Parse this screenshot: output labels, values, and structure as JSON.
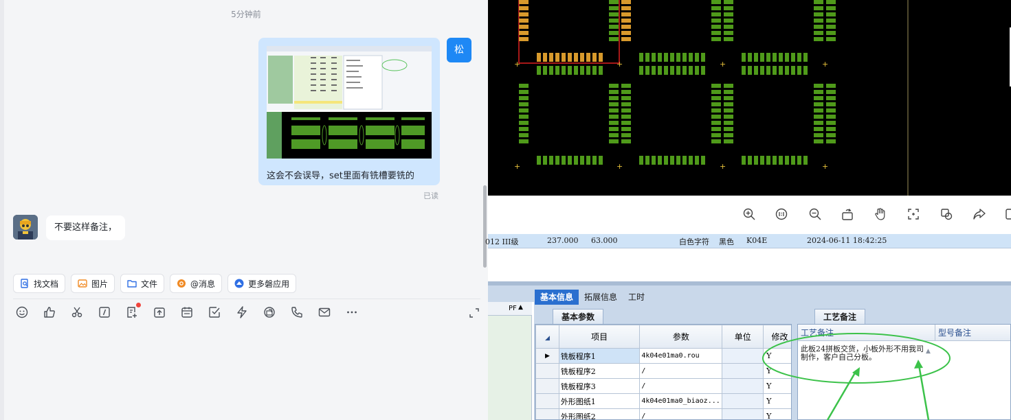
{
  "chat": {
    "timestamp": "5分钟前",
    "my_avatar_text": "松",
    "my_message": "这会不会误导，set里面有铣槽要铣的",
    "read_status": "已读",
    "other_message": "不要这样备注，",
    "quick_actions": [
      {
        "label": "找文档",
        "icon": "doc-search-icon",
        "color": "#2f6fe4"
      },
      {
        "label": "图片",
        "icon": "image-icon",
        "color": "#f08a24"
      },
      {
        "label": "文件",
        "icon": "folder-icon",
        "color": "#2f6fe4"
      },
      {
        "label": "@消息",
        "icon": "at-icon",
        "color": "#f08a24"
      },
      {
        "label": "更多磐应用",
        "icon": "apps-icon",
        "color": "#2f6fe4"
      }
    ],
    "toolbar_icons": [
      "emoji-icon",
      "thumbs-up-icon",
      "scissors-icon",
      "slash-command-icon",
      "notes-add-icon",
      "upload-icon",
      "calendar-icon",
      "checkbox-icon",
      "lightning-icon",
      "screen-share-icon",
      "call-icon",
      "mail-icon",
      "more-icon"
    ]
  },
  "viewer": {
    "toolbar_icons": [
      "zoom-in-icon",
      "actual-size-icon",
      "zoom-out-icon",
      "rotate-icon",
      "hand-icon",
      "crop-icon",
      "copy-icon",
      "share-icon",
      "save-icon"
    ]
  },
  "record": {
    "c1": "012 III级",
    "c2": "237.000",
    "c3": "63.000",
    "c4": "白色字符",
    "c5": "黑色",
    "c6": "K04E",
    "c7": "2024-06-11 18:42:25"
  },
  "erp": {
    "left_header": "PF",
    "tabs": [
      "基本信息",
      "拓展信息",
      "工时"
    ],
    "group_basic": "基本参数",
    "group_notes": "工艺备注",
    "columns": {
      "item": "项目",
      "param": "参数",
      "unit": "单位",
      "mod": "修改"
    },
    "rows": [
      {
        "item": "铣板程序1",
        "param": "4k04e01ma0.rou",
        "flag": "Y"
      },
      {
        "item": "铣板程序2",
        "param": "/",
        "flag": "Y"
      },
      {
        "item": "铣板程序3",
        "param": "/",
        "flag": "Y"
      },
      {
        "item": "外形图纸1",
        "param": "4k04e01ma0_biaoz...",
        "flag": "Y"
      },
      {
        "item": "外形图纸2",
        "param": "/",
        "flag": "Y"
      }
    ],
    "notes_header_1": "工艺备注",
    "notes_header_2": "型号备注",
    "note_text": "此板24拼板交货，小板外形不用我司制作，客户自己分板。"
  }
}
